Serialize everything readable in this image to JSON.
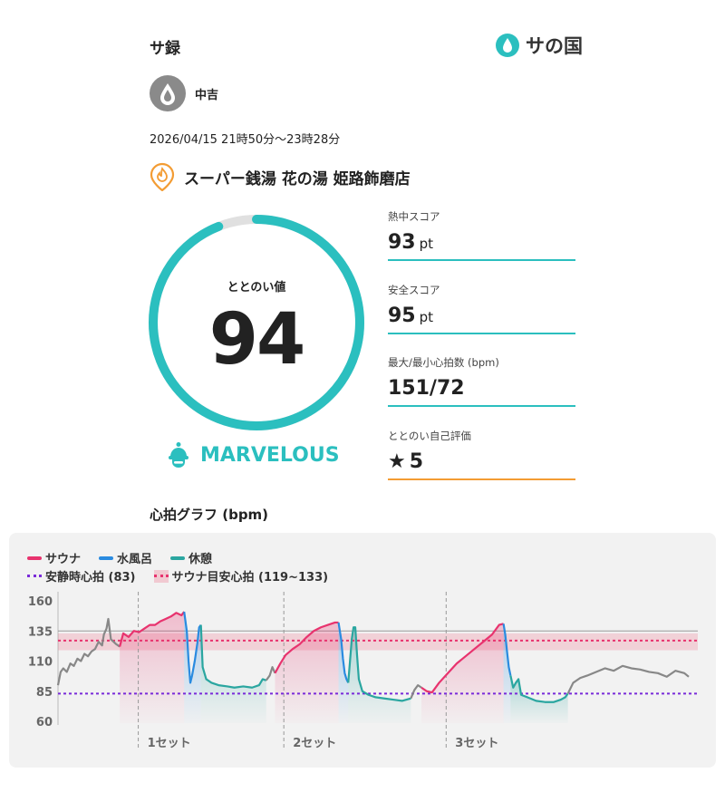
{
  "header": {
    "title": "サ録",
    "brand_text": "サの国"
  },
  "user": {
    "name": "中吉"
  },
  "session": {
    "datetime": "2026/04/15 21時50分〜23時28分",
    "facility": "スーパー銭湯 花の湯 姫路飾磨店"
  },
  "totonoi": {
    "label": "ととのい値",
    "value": "94",
    "progress": 0.94,
    "rank": "MARVELOUS"
  },
  "stats": [
    {
      "label": "熱中スコア",
      "value": "93",
      "unit": "pt"
    },
    {
      "label": "安全スコア",
      "value": "95",
      "unit": "pt"
    },
    {
      "label": "最大/最小心拍数 (bpm)",
      "value": "151/72",
      "unit": ""
    },
    {
      "label": "ととのい自己評価",
      "value": "5",
      "unit": ""
    }
  ],
  "graph": {
    "title": "心拍グラフ (bpm)",
    "legend": {
      "sauna": "サウナ",
      "cold": "水風呂",
      "rest": "休憩",
      "resting_hr": "安静時心拍 (83)",
      "target": "サウナ目安心拍 (119~133)"
    },
    "colors": {
      "sauna": "#e8336e",
      "cold": "#2a8be0",
      "rest": "#2aa6a0",
      "other": "#888888",
      "resting": "#7a2bd9",
      "accent": "#2bbfbf",
      "orange": "#f39c33"
    }
  },
  "chart_data": {
    "type": "line",
    "ylabel": "",
    "ylim": [
      60,
      160
    ],
    "yticks": [
      "160",
      "135",
      "110",
      "85",
      "60"
    ],
    "resting_hr": 83,
    "target_range": [
      119,
      133
    ],
    "target_line": 127,
    "upper_ref_line": 135,
    "set_labels": [
      "1セット",
      "2セット",
      "3セット"
    ],
    "series": [
      {
        "phase": "other",
        "values": [
          [
            0,
            90
          ],
          [
            3,
            101
          ],
          [
            6,
            104
          ],
          [
            10,
            101
          ],
          [
            14,
            108
          ],
          [
            18,
            106
          ],
          [
            22,
            112
          ],
          [
            26,
            110
          ],
          [
            30,
            116
          ],
          [
            34,
            114
          ],
          [
            38,
            118
          ],
          [
            42,
            120
          ],
          [
            46,
            126
          ],
          [
            50,
            123
          ],
          [
            52,
            132
          ],
          [
            55,
            137
          ],
          [
            57,
            145
          ],
          [
            60,
            128
          ],
          [
            63,
            126
          ],
          [
            66,
            124
          ],
          [
            70,
            122
          ]
        ]
      },
      {
        "phase": "sauna",
        "values": [
          [
            70,
            122
          ],
          [
            74,
            133
          ],
          [
            80,
            130
          ],
          [
            86,
            135
          ],
          [
            92,
            134
          ],
          [
            98,
            137
          ],
          [
            104,
            140
          ],
          [
            110,
            140
          ],
          [
            116,
            143
          ],
          [
            122,
            145
          ],
          [
            128,
            147
          ],
          [
            134,
            150
          ],
          [
            140,
            148
          ],
          [
            143,
            151
          ]
        ]
      },
      {
        "phase": "cold",
        "values": [
          [
            143,
            151
          ],
          [
            146,
            135
          ],
          [
            148,
            110
          ],
          [
            150,
            92
          ],
          [
            152,
            98
          ],
          [
            155,
            110
          ],
          [
            158,
            125
          ],
          [
            160,
            138
          ],
          [
            162,
            140
          ]
        ]
      },
      {
        "phase": "rest",
        "values": [
          [
            162,
            140
          ],
          [
            164,
            105
          ],
          [
            168,
            95
          ],
          [
            174,
            92
          ],
          [
            182,
            90
          ],
          [
            192,
            89
          ],
          [
            200,
            88
          ],
          [
            210,
            89
          ],
          [
            220,
            88
          ],
          [
            228,
            90
          ],
          [
            232,
            95
          ],
          [
            236,
            94
          ]
        ]
      },
      {
        "phase": "other",
        "values": [
          [
            236,
            94
          ],
          [
            240,
            98
          ],
          [
            243,
            105
          ],
          [
            246,
            100
          ]
        ]
      },
      {
        "phase": "sauna",
        "values": [
          [
            246,
            100
          ],
          [
            252,
            108
          ],
          [
            258,
            115
          ],
          [
            266,
            120
          ],
          [
            274,
            124
          ],
          [
            282,
            130
          ],
          [
            290,
            135
          ],
          [
            298,
            138
          ],
          [
            306,
            140
          ],
          [
            314,
            142
          ],
          [
            318,
            142
          ]
        ]
      },
      {
        "phase": "cold",
        "values": [
          [
            318,
            142
          ],
          [
            321,
            128
          ],
          [
            323,
            112
          ],
          [
            325,
            100
          ],
          [
            327,
            95
          ],
          [
            329,
            92
          ]
        ]
      },
      {
        "phase": "rest",
        "values": [
          [
            329,
            92
          ],
          [
            331,
            110
          ],
          [
            333,
            128
          ],
          [
            335,
            138
          ],
          [
            337,
            138
          ],
          [
            339,
            115
          ],
          [
            341,
            95
          ],
          [
            345,
            85
          ],
          [
            352,
            82
          ],
          [
            360,
            80
          ],
          [
            370,
            79
          ],
          [
            380,
            78
          ],
          [
            390,
            77
          ],
          [
            400,
            79
          ]
        ]
      },
      {
        "phase": "other",
        "values": [
          [
            400,
            79
          ],
          [
            404,
            86
          ],
          [
            408,
            90
          ],
          [
            412,
            88
          ]
        ]
      },
      {
        "phase": "sauna",
        "values": [
          [
            412,
            88
          ],
          [
            418,
            85
          ],
          [
            424,
            84
          ],
          [
            432,
            92
          ],
          [
            442,
            100
          ],
          [
            452,
            108
          ],
          [
            462,
            114
          ],
          [
            472,
            120
          ],
          [
            482,
            126
          ],
          [
            492,
            132
          ],
          [
            500,
            140
          ],
          [
            505,
            141
          ]
        ]
      },
      {
        "phase": "cold",
        "values": [
          [
            505,
            141
          ],
          [
            507,
            132
          ],
          [
            509,
            118
          ],
          [
            511,
            105
          ],
          [
            513,
            98
          ]
        ]
      },
      {
        "phase": "rest",
        "values": [
          [
            513,
            98
          ],
          [
            516,
            88
          ],
          [
            519,
            92
          ],
          [
            522,
            95
          ],
          [
            525,
            82
          ],
          [
            532,
            80
          ],
          [
            542,
            77
          ],
          [
            552,
            76
          ],
          [
            562,
            76
          ],
          [
            570,
            78
          ],
          [
            575,
            80
          ],
          [
            578,
            83
          ]
        ]
      },
      {
        "phase": "other",
        "values": [
          [
            578,
            83
          ],
          [
            584,
            92
          ],
          [
            592,
            96
          ],
          [
            600,
            98
          ],
          [
            610,
            101
          ],
          [
            620,
            104
          ],
          [
            630,
            102
          ],
          [
            640,
            106
          ],
          [
            650,
            104
          ],
          [
            660,
            103
          ],
          [
            670,
            101
          ],
          [
            680,
            100
          ],
          [
            690,
            97
          ],
          [
            700,
            102
          ],
          [
            710,
            100
          ],
          [
            715,
            97
          ]
        ]
      }
    ],
    "phase_bands": [
      {
        "phase": "sauna",
        "from": 70,
        "to": 143
      },
      {
        "phase": "cold",
        "from": 143,
        "to": 162
      },
      {
        "phase": "rest",
        "from": 162,
        "to": 236
      },
      {
        "phase": "sauna",
        "from": 246,
        "to": 318
      },
      {
        "phase": "cold",
        "from": 318,
        "to": 329
      },
      {
        "phase": "rest",
        "from": 329,
        "to": 400
      },
      {
        "phase": "sauna",
        "from": 412,
        "to": 505
      },
      {
        "phase": "cold",
        "from": 505,
        "to": 513
      },
      {
        "phase": "rest",
        "from": 513,
        "to": 578
      }
    ],
    "set_boundaries": [
      91,
      256,
      440
    ]
  }
}
